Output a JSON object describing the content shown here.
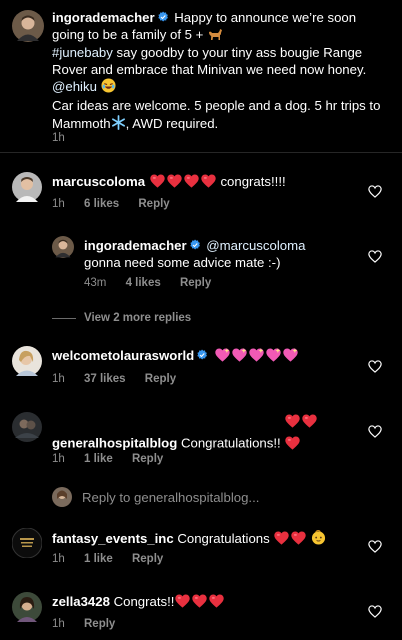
{
  "caption": {
    "username": "ingorademacher",
    "line1": "Happy to announce we’re soon going to be a family of 5 +",
    "hashtag": "#junebaby",
    "line2": " say goodby to your tiny ass bougie Range Rover and embrace that Minivan we need now honey.",
    "mention": "@ehiku",
    "line3": "Car ideas are welcome.  5 people and a dog. 5 hr trips to Mammoth",
    "line4": ", AWD required.",
    "time": "1h"
  },
  "comments": [
    {
      "username": "marcuscoloma",
      "text": "congrats!!!!",
      "time": "1h",
      "likes": "6 likes",
      "reply": "Reply"
    },
    {
      "username": "ingorademacher",
      "mention": "@marcuscoloma",
      "text": "gonna need some advice mate :-)",
      "time": "43m",
      "likes": "4 likes",
      "reply": "Reply"
    },
    {
      "username": "welcometolaurasworld",
      "time": "1h",
      "likes": "37 likes",
      "reply": "Reply"
    },
    {
      "username": "generalhospitalblog",
      "text": "Congratulations!!",
      "time": "1h",
      "likes": "1 like",
      "reply": "Reply"
    },
    {
      "username": "fantasy_events_inc",
      "text": "Congratulations",
      "time": "1h",
      "likes": "1 like",
      "reply": "Reply"
    },
    {
      "username": "zella3428",
      "text": "Congrats!!",
      "time": "1h",
      "reply": "Reply"
    }
  ],
  "view_more": "View 2 more replies",
  "reply_placeholder": "Reply to generalhospitalblog...",
  "colors": {
    "background": "#000000",
    "secondary_text": "#8e8e8e",
    "verified": "#3897f0",
    "heart": "#e0245e"
  }
}
